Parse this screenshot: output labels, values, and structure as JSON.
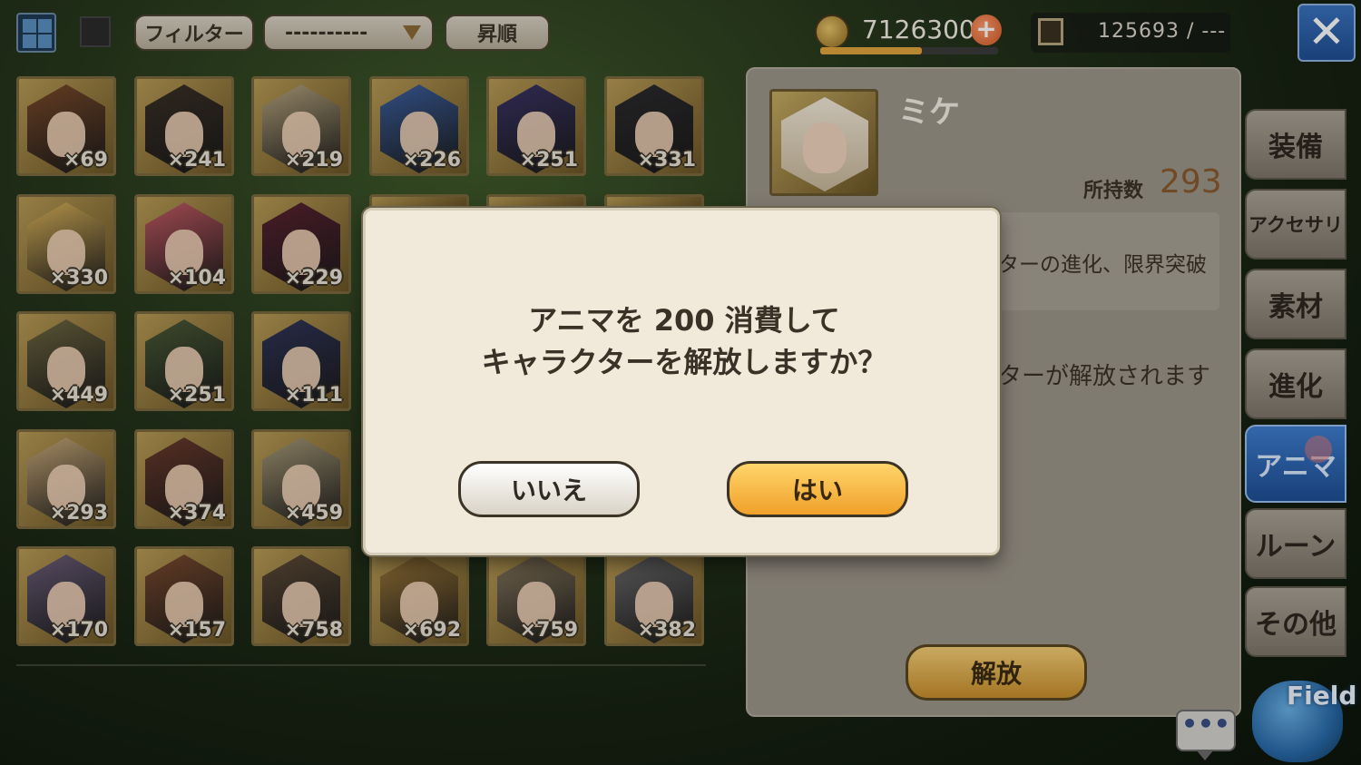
{
  "toolbar": {
    "filter_label": "フィルター",
    "select_value": "----------",
    "sort_label": "昇順"
  },
  "currency": {
    "coins": "7126300",
    "coin_bar_fraction": 0.57,
    "storage": "125693 / ---"
  },
  "grid": {
    "cards": [
      {
        "count": "×69",
        "color": "#7a4a2a"
      },
      {
        "count": "×241",
        "color": "#3a3026"
      },
      {
        "count": "×219",
        "color": "#b7a57e"
      },
      {
        "count": "×226",
        "color": "#3c5f9e"
      },
      {
        "count": "×251",
        "color": "#3a3364"
      },
      {
        "count": "×331",
        "color": "#2c2b2e"
      },
      {
        "count": "×330",
        "color": "#d9b25a"
      },
      {
        "count": "×104",
        "color": "#c25a63"
      },
      {
        "count": "×229",
        "color": "#5a2230"
      },
      {
        "count": "×449",
        "color": "#6d6640"
      },
      {
        "count": "×251",
        "color": "#4a5a36"
      },
      {
        "count": "×111",
        "color": "#2f3558"
      },
      {
        "count": "×293",
        "color": "#c9a978"
      },
      {
        "count": "×374",
        "color": "#6a3a2c"
      },
      {
        "count": "×459",
        "color": "#a89a77"
      },
      {
        "count": "×170",
        "color": "#6a5d78"
      },
      {
        "count": "×157",
        "color": "#7a4a2e"
      },
      {
        "count": "×758",
        "color": "#5d4a36"
      },
      {
        "count": "×692",
        "color": "#a07a3a"
      },
      {
        "count": "×759",
        "color": "#8a7a5e"
      },
      {
        "count": "×382",
        "color": "#6e6c6e"
      }
    ]
  },
  "detail": {
    "name": "ミケ",
    "owned_label": "所持数",
    "owned_value": "293",
    "description_partial": "ターの進化、限界突破",
    "note_partial": "ターが解放されます",
    "release_button": "解放"
  },
  "tabs": [
    "装備",
    "アクセサリ",
    "素材",
    "進化",
    "アニマ",
    "ルーン",
    "その他"
  ],
  "active_tab": "アニマ",
  "field_label": "Field",
  "chat_label": "•••",
  "modal": {
    "line1": "アニマを 200 消費して",
    "line2": "キャラクターを解放しますか？",
    "no_label": "いいえ",
    "yes_label": "はい"
  },
  "colors": {
    "accent_blue": "#2f67b5",
    "gold": "#e9b148",
    "panel": "#9d968a"
  }
}
